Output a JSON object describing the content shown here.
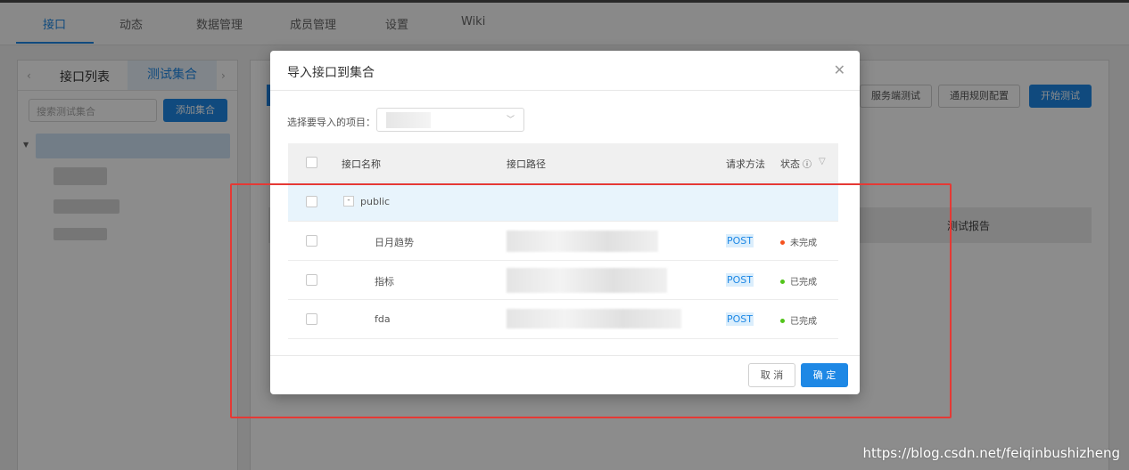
{
  "top_tabs": [
    {
      "label": "接口",
      "active": true
    },
    {
      "label": "动态",
      "active": false
    },
    {
      "label": "数据管理",
      "active": false
    },
    {
      "label": "成员管理",
      "active": false
    },
    {
      "label": "设置",
      "active": false
    },
    {
      "label": "Wiki",
      "active": false
    }
  ],
  "left_panel": {
    "tab_interfaces": "接口列表",
    "tab_collections": "测试集合",
    "search_placeholder": "搜索测试集合",
    "add_button": "添加集合"
  },
  "main_panel": {
    "buttons": [
      "服务端测试",
      "通用规则配置",
      "开始测试"
    ],
    "column_report": "测试报告"
  },
  "modal": {
    "title": "导入接口到集合",
    "project_label": "选择要导入的项目：",
    "columns": {
      "name": "接口名称",
      "path": "接口路径",
      "method": "请求方法",
      "status": "状态"
    },
    "group": {
      "name": "public",
      "expander": "-"
    },
    "rows": [
      {
        "name": "日月趋势",
        "method": "POST",
        "status": "未完成",
        "status_color": "#f5511e"
      },
      {
        "name": "指标",
        "method": "POST",
        "status": "已完成",
        "status_color": "#52c41a"
      },
      {
        "name": "fda",
        "method": "POST",
        "status": "已完成",
        "status_color": "#52c41a"
      }
    ],
    "cancel": "取 消",
    "ok": "确 定"
  },
  "colors": {
    "accent": "#1e88e5",
    "annotation_red": "#e53935"
  },
  "watermark": "https://blog.csdn.net/feiqinbushizheng"
}
